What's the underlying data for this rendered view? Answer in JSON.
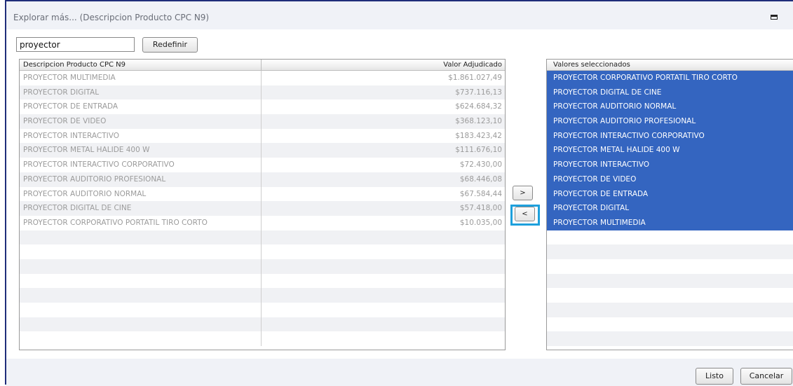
{
  "dialog": {
    "title": "Explorar más... (Descripcion Producto CPC N9)"
  },
  "search": {
    "value": "proyector",
    "reset_label": "Redefinir"
  },
  "grid": {
    "col_desc": "Descripcion Producto CPC N9",
    "col_value": "Valor Adjudicado",
    "rows": [
      {
        "desc": "PROYECTOR MULTIMEDIA",
        "value": "$1.861.027,49"
      },
      {
        "desc": "PROYECTOR DIGITAL",
        "value": "$737.116,13"
      },
      {
        "desc": "PROYECTOR DE ENTRADA",
        "value": "$624.684,32"
      },
      {
        "desc": "PROYECTOR DE VIDEO",
        "value": "$368.123,10"
      },
      {
        "desc": "PROYECTOR INTERACTIVO",
        "value": "$183.423,42"
      },
      {
        "desc": "PROYECTOR METAL HALIDE 400 W",
        "value": "$111.676,10"
      },
      {
        "desc": "PROYECTOR INTERACTIVO CORPORATIVO",
        "value": "$72.430,00"
      },
      {
        "desc": "PROYECTOR AUDITORIO PROFESIONAL",
        "value": "$68.446,08"
      },
      {
        "desc": "PROYECTOR AUDITORIO NORMAL",
        "value": "$67.584,44"
      },
      {
        "desc": "PROYECTOR DIGITAL DE CINE",
        "value": "$57.418,00"
      },
      {
        "desc": "PROYECTOR CORPORATIVO PORTATIL TIRO CORTO",
        "value": "$10.035,00"
      }
    ]
  },
  "move": {
    "add_label": ">",
    "remove_label": "<"
  },
  "selected": {
    "header": "Valores seleccionados",
    "items": [
      "PROYECTOR CORPORATIVO PORTATIL TIRO CORTO",
      "PROYECTOR DIGITAL DE CINE",
      "PROYECTOR AUDITORIO NORMAL",
      "PROYECTOR AUDITORIO PROFESIONAL",
      "PROYECTOR INTERACTIVO CORPORATIVO",
      "PROYECTOR METAL HALIDE 400 W",
      "PROYECTOR INTERACTIVO",
      "PROYECTOR DE VIDEO",
      "PROYECTOR DE ENTRADA",
      "PROYECTOR DIGITAL",
      "PROYECTOR MULTIMEDIA"
    ]
  },
  "footer": {
    "ok_label": "Listo",
    "cancel_label": "Cancelar"
  },
  "colors": {
    "selection": "#3465c0",
    "highlight": "#1ea0dc",
    "frame": "#1f2d7a"
  }
}
